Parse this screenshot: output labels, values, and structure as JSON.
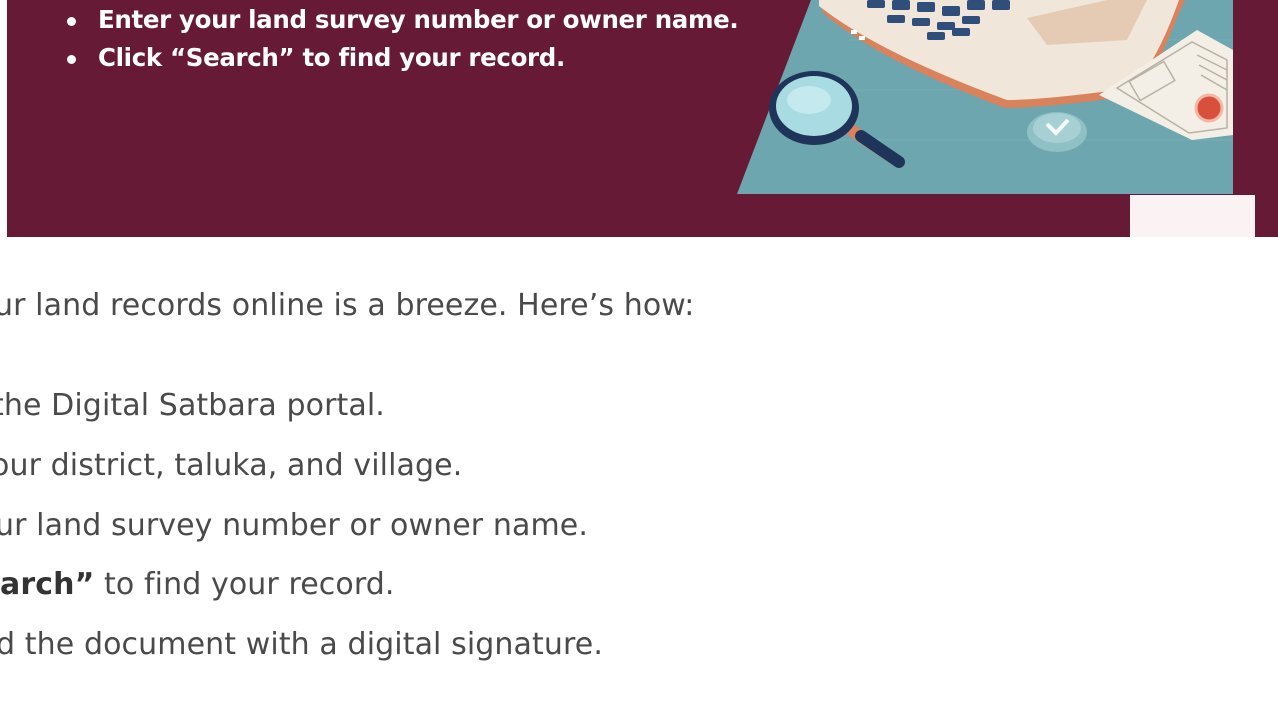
{
  "banner": {
    "bullets": [
      "Enter your land survey number or owner name.",
      "Click “Search” to find your record."
    ]
  },
  "article": {
    "intro": "ur land records online is a breeze. Here’s how:",
    "steps": [
      {
        "bold": "",
        "text": " the Digital Satbara portal."
      },
      {
        "bold": "",
        "text": "our district, taluka, and village."
      },
      {
        "bold": "",
        "text": "ur land survey number or owner name."
      },
      {
        "bold": "arch”",
        "text": " to find your record."
      },
      {
        "bold": "",
        "text": "d the document with a digital signature."
      }
    ]
  },
  "icons": [
    "laptop-icon",
    "magnifying-glass-icon",
    "document-icon",
    "seal-icon",
    "verified-badge-icon"
  ],
  "colors": {
    "banner_bg": "#671a35",
    "banner_text": "#ffffff",
    "body_text": "#4a4a4a",
    "illustration_bg": "#6da6ae",
    "laptop_body": "#f0e6d9",
    "laptop_accent": "#d9825b"
  }
}
